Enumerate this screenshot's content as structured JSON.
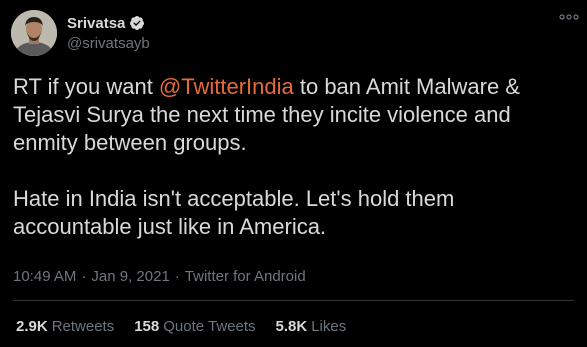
{
  "author": {
    "name": "Srivatsa",
    "handle": "@srivatsayb",
    "verified": true
  },
  "tweet": {
    "line1_before": "RT if you want ",
    "mention": "@TwitterIndia",
    "line1_after": " to ban Amit Malware & Tejasvi Surya the next time they incite violence and enmity between groups.",
    "paragraph2": "Hate in India isn't acceptable. Let's hold them accountable just like in America."
  },
  "meta": {
    "time": "10:49 AM",
    "sep1": "·",
    "date": "Jan 9, 2021",
    "sep2": "·",
    "source": "Twitter for Android"
  },
  "stats": [
    {
      "value": "2.9K",
      "label": "Retweets"
    },
    {
      "value": "158",
      "label": "Quote Tweets"
    },
    {
      "value": "5.8K",
      "label": "Likes"
    }
  ],
  "icons": {
    "verified": "verified-badge-icon",
    "more": "more-options-icon"
  },
  "colors": {
    "background": "#000000",
    "text": "#d9d9d9",
    "muted": "#6e767d",
    "mention": "#e8693b"
  }
}
